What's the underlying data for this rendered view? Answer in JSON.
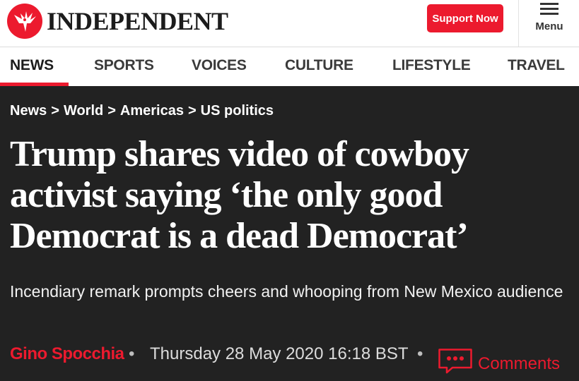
{
  "brand": {
    "name": "INDEPENDENT",
    "accent": "#ec1a2e"
  },
  "header": {
    "support_label": "Support Now",
    "menu_label": "Menu"
  },
  "nav": {
    "items": [
      {
        "label": "NEWS",
        "active": true
      },
      {
        "label": "SPORTS"
      },
      {
        "label": "VOICES"
      },
      {
        "label": "CULTURE"
      },
      {
        "label": "LIFESTYLE"
      },
      {
        "label": "TRAVEL"
      }
    ]
  },
  "breadcrumb": {
    "items": [
      "News",
      "World",
      "Americas",
      "US politics"
    ],
    "separator": ">"
  },
  "article": {
    "headline": "Trump shares video of cowboy activist saying ‘the only good Democrat is a dead Democrat’",
    "standfirst": "Incendiary remark prompts cheers and whooping from New Mexico audience",
    "author": "Gino Spocchia",
    "bullet": "•",
    "date": "Thursday 28 May 2020 16:18 BST",
    "comments_label": "Comments",
    "comments_icon": "speech-bubble-icon"
  }
}
